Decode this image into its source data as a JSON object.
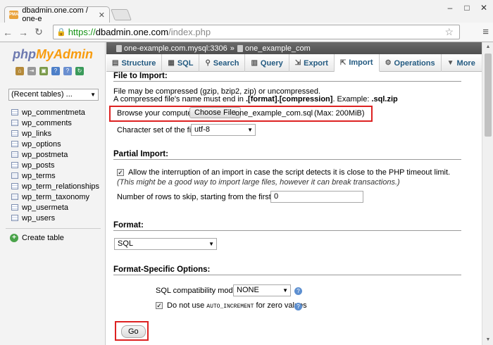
{
  "browser": {
    "tab_title": "dbadmin.one.com / one-e",
    "url_scheme": "https://",
    "url_host": "dbadmin.one.com",
    "url_path": "/index.php"
  },
  "sidebar": {
    "logo_php": "php",
    "logo_myadmin": "MyAdmin",
    "recent": "(Recent tables) ...",
    "tables": [
      "wp_commentmeta",
      "wp_comments",
      "wp_links",
      "wp_options",
      "wp_postmeta",
      "wp_posts",
      "wp_terms",
      "wp_term_relationships",
      "wp_term_taxonomy",
      "wp_usermeta",
      "wp_users"
    ],
    "create_table": "Create table"
  },
  "breadcrumb": {
    "server": "one-example.com.mysql:3306",
    "sep": "»",
    "db": "one_example_com"
  },
  "menu": [
    {
      "label": "Structure",
      "icon": "structure-icon"
    },
    {
      "label": "SQL",
      "icon": "sql-icon"
    },
    {
      "label": "Search",
      "icon": "search-icon"
    },
    {
      "label": "Query",
      "icon": "query-icon"
    },
    {
      "label": "Export",
      "icon": "export-icon"
    },
    {
      "label": "Import",
      "icon": "import-icon"
    },
    {
      "label": "Operations",
      "icon": "operations-icon"
    },
    {
      "label": "More",
      "icon": "chevron-down-icon"
    }
  ],
  "file_import": {
    "legend": "File to Import:",
    "note1": "File may be compressed (gzip, bzip2, zip) or uncompressed.",
    "note2_a": "A compressed file's name must end in ",
    "note2_b": ".[format].[compression]",
    "note2_c": ". Example: ",
    "note2_d": ".sql.zip",
    "browse_label": "Browse your computer:",
    "choose_file": "Choose File",
    "file_name": "one_example_com.sql",
    "max": "(Max: 200MiB)",
    "charset_label": "Character set of the file:",
    "charset_value": "utf-8"
  },
  "partial": {
    "legend": "Partial Import:",
    "allow_text": "Allow the interruption of an import in case the script detects it is close to the PHP timeout limit.",
    "allow_hint": "(This might be a good way to import large files, however it can break transactions.)",
    "skip_label": "Number of rows to skip, starting from the first row:",
    "skip_value": "0"
  },
  "format": {
    "legend": "Format:",
    "value": "SQL"
  },
  "fso": {
    "legend": "Format-Specific Options:",
    "compat_label": "SQL compatibility mode:",
    "compat_value": "NONE",
    "no_ai_a": "Do not use ",
    "no_ai_b": "AUTO_INCREMENT",
    "no_ai_c": " for zero values"
  },
  "go": "Go"
}
